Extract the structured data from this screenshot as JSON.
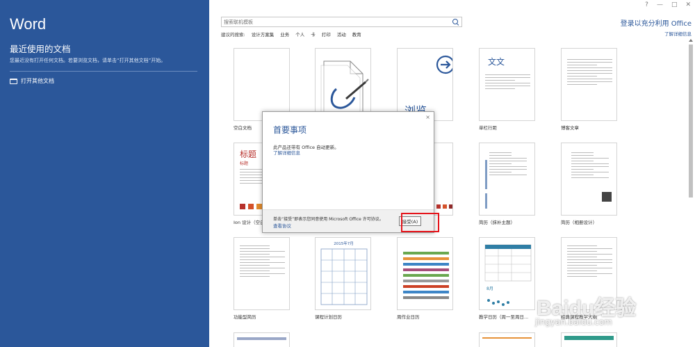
{
  "left": {
    "app_title": "Word",
    "recent_title": "最近使用的文档",
    "recent_desc": "您最近没有打开任何文档。若要浏览文档，请单击“打开其他文档”开始。",
    "open_other": "打开其他文档"
  },
  "window": {
    "help": "?",
    "minimize": "—",
    "restore": "□",
    "close": "✕"
  },
  "search": {
    "placeholder": "搜索联机模板"
  },
  "suggested": {
    "label": "建议的搜索:",
    "items": [
      "设计方案集",
      "业务",
      "个人",
      "卡",
      "打印",
      "活动",
      "教育"
    ]
  },
  "account": {
    "signin": "登录以充分利用 Office",
    "more_info": "了解详细信息"
  },
  "templates": {
    "row1": [
      {
        "label": "空白文档"
      },
      {
        "label": ""
      },
      {
        "label": "",
        "thumb_text": "浏览"
      },
      {
        "label": "单栏行距",
        "thumb_text": "文文"
      },
      {
        "label": "博客文章"
      }
    ],
    "row2": [
      {
        "label": "Ion 设计（空白",
        "thumb_title": "标题",
        "thumb_sub": "标题"
      },
      {
        "label": ""
      },
      {
        "label": ""
      },
      {
        "label": "简历（抹补主题）"
      },
      {
        "label": "简历（相册设计）"
      }
    ],
    "row3": [
      {
        "label": "功能型简历"
      },
      {
        "label": "课程计划日历",
        "thumb_title": "2015年7月"
      },
      {
        "label": "周作业日历"
      },
      {
        "label": "教学日历（周一至周日...",
        "thumb_month": "8月"
      },
      {
        "label": "经典课程教学大纲"
      }
    ]
  },
  "dialog": {
    "title": "首要事项",
    "message": "此产品还带有 Office 自动更新。",
    "learn_more": "了解详细信息",
    "license": "单击“接受”即表示您同意使用 Microsoft Office 许可协议。",
    "view_agreement": "查看协议",
    "accept": "接受(A)",
    "close": "×"
  },
  "watermark": {
    "brand": "Baidu经验",
    "url": "jingyan.baidu.com"
  },
  "colors": {
    "accent": "#2b579a",
    "highlight": "#e5141b",
    "ion_red": "#b7312c"
  }
}
